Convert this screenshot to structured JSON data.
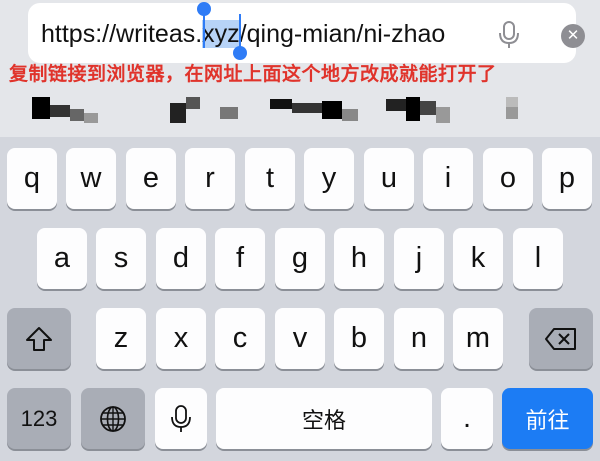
{
  "url_bar": {
    "url_before": "https://writeas.",
    "url_selected": "xyz",
    "url_after": "/qing-mian/ni-zhao",
    "mic_icon": "microphone-icon",
    "clear_icon": "clear-icon",
    "clear_symbol": "✕"
  },
  "annotation": {
    "text": "复制链接到浏览器，在网址上面这个地方改成就能打开了",
    "color": "#e0332b"
  },
  "keyboard": {
    "row1": [
      "q",
      "w",
      "e",
      "r",
      "t",
      "y",
      "u",
      "i",
      "o",
      "p"
    ],
    "row2": [
      "a",
      "s",
      "d",
      "f",
      "g",
      "h",
      "j",
      "k",
      "l"
    ],
    "row3": [
      "z",
      "x",
      "c",
      "v",
      "b",
      "n",
      "m"
    ],
    "shift_icon": "shift-icon",
    "delete_icon": "backspace-icon",
    "numbers_label": "123",
    "globe_icon": "globe-icon",
    "mic_icon": "microphone-icon",
    "space_label": "空格",
    "period_label": ".",
    "go_label": "前往"
  },
  "colors": {
    "accent": "#1c7cf4",
    "selection": "#b7d3f7",
    "keyboard_bg": "#d3d6dd"
  }
}
